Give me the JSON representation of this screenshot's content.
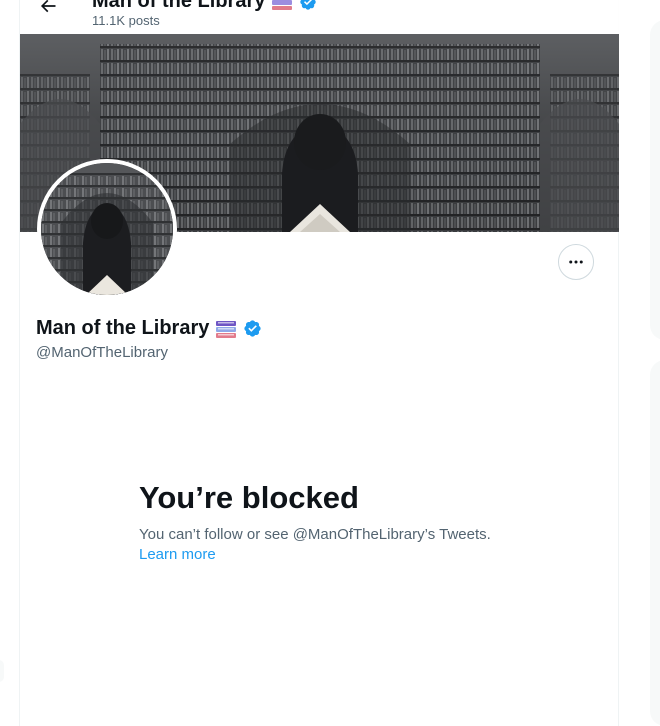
{
  "header": {
    "title": "Man of the Library",
    "posts": "11.1K posts"
  },
  "profile": {
    "name": "Man of the Library",
    "handle": "@ManOfTheLibrary"
  },
  "blocked": {
    "title": "You’re blocked",
    "message": "You can’t follow or see @ManOfTheLibrary’s Tweets.",
    "learn_more": "Learn more"
  },
  "icons": {
    "back": "arrow-left-icon",
    "verified": "verified-badge-icon",
    "books": "books-emoji-icon",
    "more": "more-icon"
  },
  "colors": {
    "accent": "#1d9bf0",
    "secondary_text": "#536471",
    "primary_text": "#0f1419"
  }
}
